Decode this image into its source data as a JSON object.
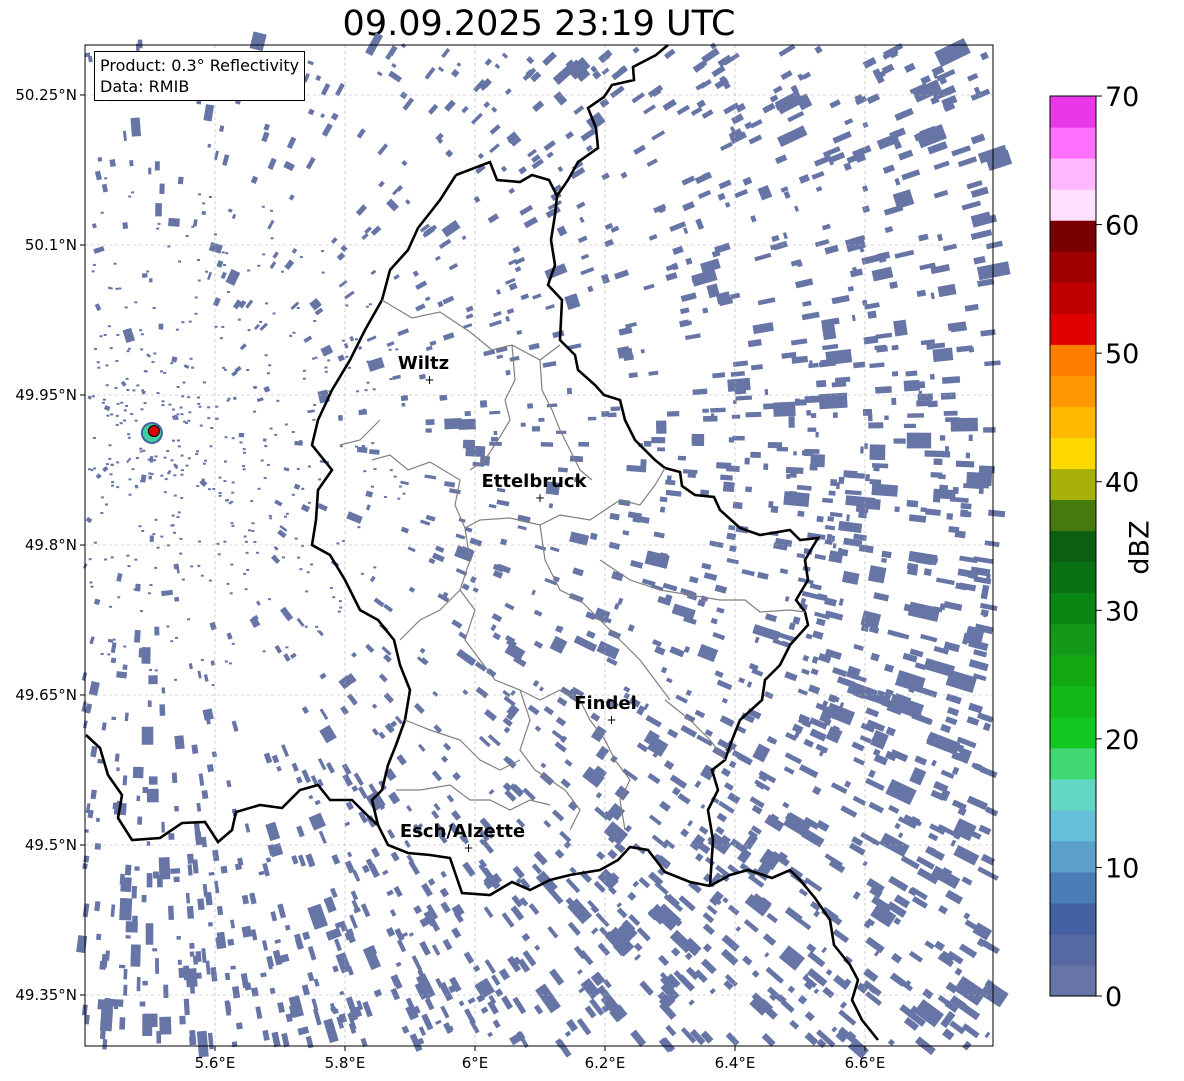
{
  "title": "09.09.2025 23:19 UTC",
  "info": {
    "product": "Product: 0.3° Reflectivity",
    "data": "Data: RMIB"
  },
  "map": {
    "lon_range": [
      5.4,
      6.8
    ],
    "lat_range": [
      49.3,
      50.3
    ],
    "lon_ticks": [
      {
        "v": 5.6,
        "label": "5.6°E"
      },
      {
        "v": 5.8,
        "label": "5.8°E"
      },
      {
        "v": 6.0,
        "label": "6°E"
      },
      {
        "v": 6.2,
        "label": "6.2°E"
      },
      {
        "v": 6.4,
        "label": "6.4°E"
      },
      {
        "v": 6.6,
        "label": "6.6°E"
      }
    ],
    "lat_ticks": [
      {
        "v": 50.25,
        "label": "50.25°N"
      },
      {
        "v": 50.1,
        "label": "50.1°N"
      },
      {
        "v": 49.95,
        "label": "49.95°N"
      },
      {
        "v": 49.8,
        "label": "49.8°N"
      },
      {
        "v": 49.65,
        "label": "49.65°N"
      },
      {
        "v": 49.5,
        "label": "49.5°N"
      },
      {
        "v": 49.35,
        "label": "49.35°N"
      }
    ],
    "gridlines": true,
    "radar_site": {
      "lon": 5.506,
      "lat": 49.914
    },
    "cities": [
      {
        "name": "Wiltz",
        "lon": 5.93,
        "lat": 49.966
      },
      {
        "name": "Ettelbruck",
        "lon": 6.1,
        "lat": 49.848
      },
      {
        "name": "Findel",
        "lon": 6.21,
        "lat": 49.626
      },
      {
        "name": "Esch/Alzette",
        "lon": 5.99,
        "lat": 49.498
      }
    ]
  },
  "colorbar": {
    "label": "dBZ",
    "min": 0,
    "max": 70,
    "ticks": [
      {
        "v": 0,
        "label": "0"
      },
      {
        "v": 10,
        "label": "10"
      },
      {
        "v": 20,
        "label": "20"
      },
      {
        "v": 30,
        "label": "30"
      },
      {
        "v": 40,
        "label": "40"
      },
      {
        "v": 50,
        "label": "50"
      },
      {
        "v": 60,
        "label": "60"
      },
      {
        "v": 70,
        "label": "70"
      }
    ],
    "colors": [
      "#6675a6",
      "#5669a3",
      "#4360a3",
      "#4a7cb5",
      "#5aa0c8",
      "#66c0da",
      "#62d8c4",
      "#40d870",
      "#10c820",
      "#12b818",
      "#12a814",
      "#149818",
      "#0a8612",
      "#0a7214",
      "#0a6010",
      "#467a0e",
      "#a8b00a",
      "#ffd800",
      "#ffb800",
      "#ff9800",
      "#ff7e00",
      "#e00000",
      "#c00000",
      "#a00000",
      "#780000",
      "#ffe0ff",
      "#ffb8ff",
      "#ff70ff",
      "#e838e8"
    ]
  }
}
